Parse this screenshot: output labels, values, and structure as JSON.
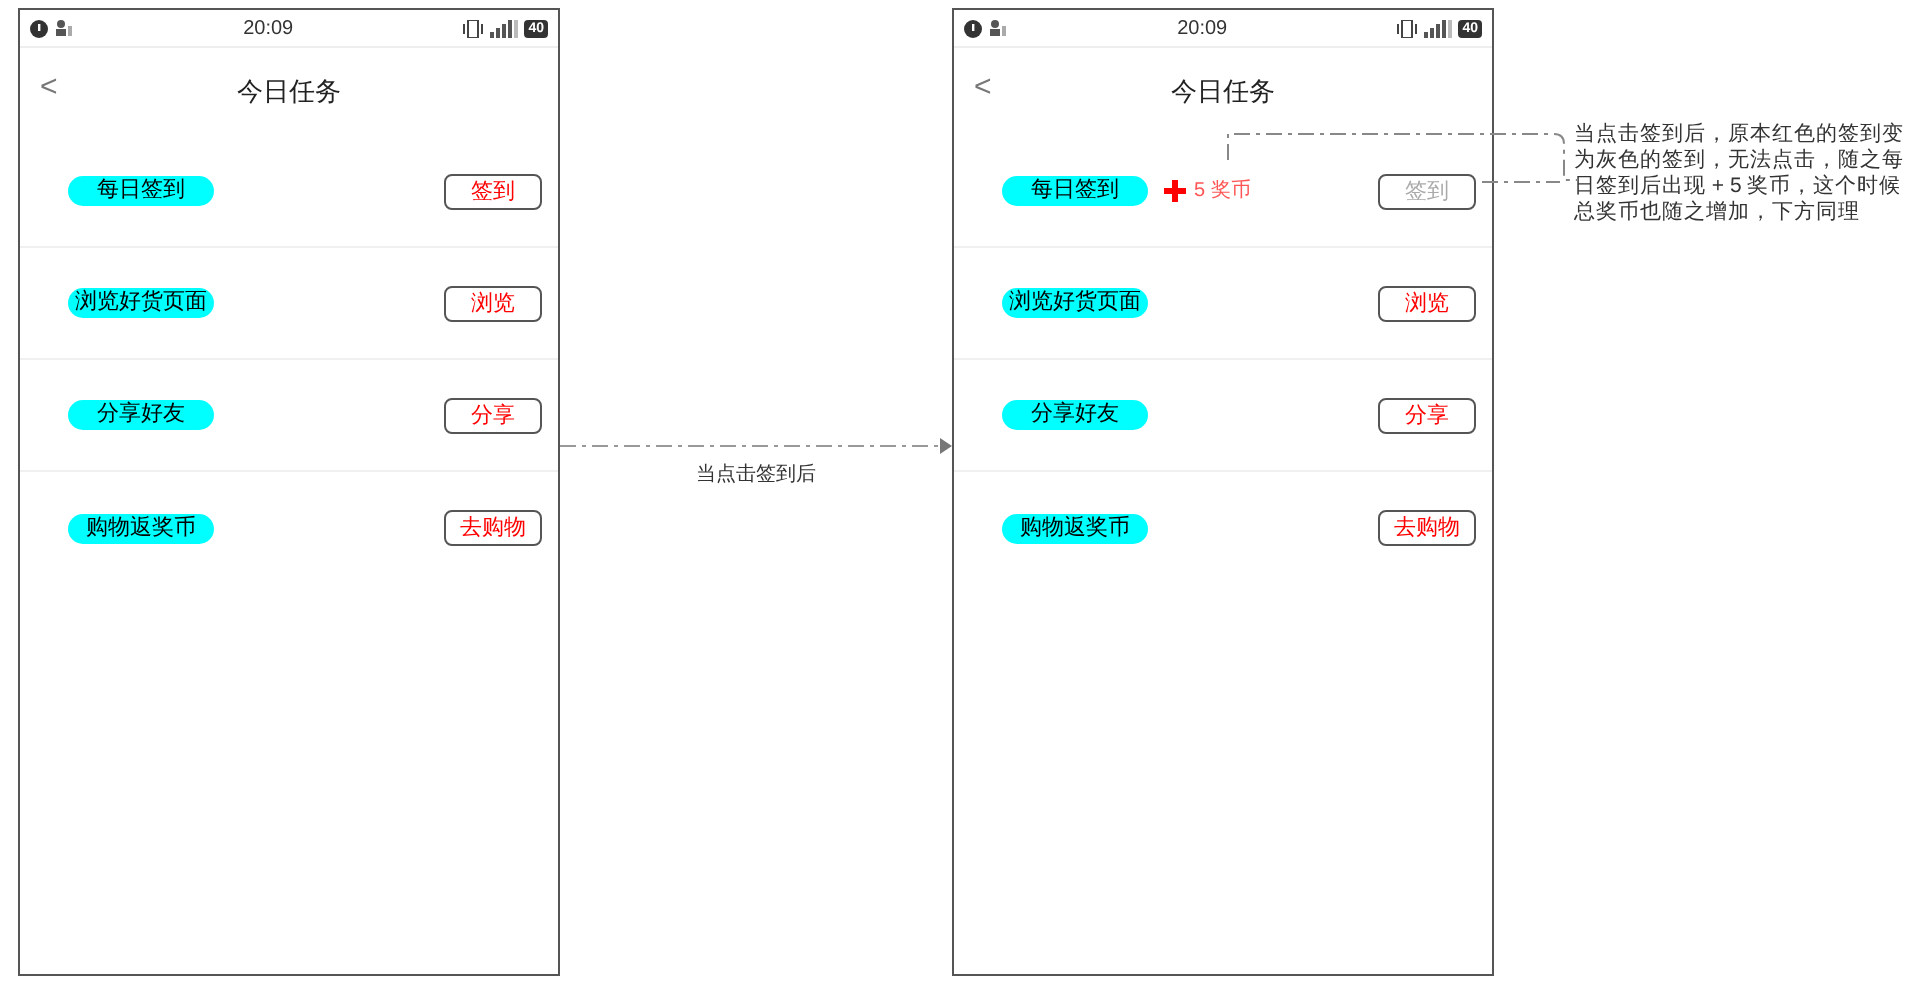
{
  "phones": [
    {
      "status": {
        "time": "20:09",
        "battery": "40"
      },
      "back": "<",
      "title": "今日任务",
      "tasks": [
        {
          "name": "每日签到",
          "action": "签到",
          "disabled": false
        },
        {
          "name": "浏览好货页面",
          "action": "浏览",
          "disabled": false
        },
        {
          "name": "分享好友",
          "action": "分享",
          "disabled": false
        },
        {
          "name": "购物返奖币",
          "action": "去购物",
          "disabled": false
        }
      ]
    },
    {
      "status": {
        "time": "20:09",
        "battery": "40"
      },
      "back": "<",
      "title": "今日任务",
      "tasks": [
        {
          "name": "每日签到",
          "action": "签到",
          "disabled": true,
          "reward": "5 奖币"
        },
        {
          "name": "浏览好货页面",
          "action": "浏览",
          "disabled": false
        },
        {
          "name": "分享好友",
          "action": "分享",
          "disabled": false
        },
        {
          "name": "购物返奖币",
          "action": "去购物",
          "disabled": false
        }
      ]
    }
  ],
  "transition": {
    "label": "当点击签到后"
  },
  "note": {
    "text": "当点击签到后，原本红色的签到变为灰色的签到，无法点击，随之每日签到后出现 + 5 奖币，这个时候总奖币也随之增加，下方同理"
  }
}
